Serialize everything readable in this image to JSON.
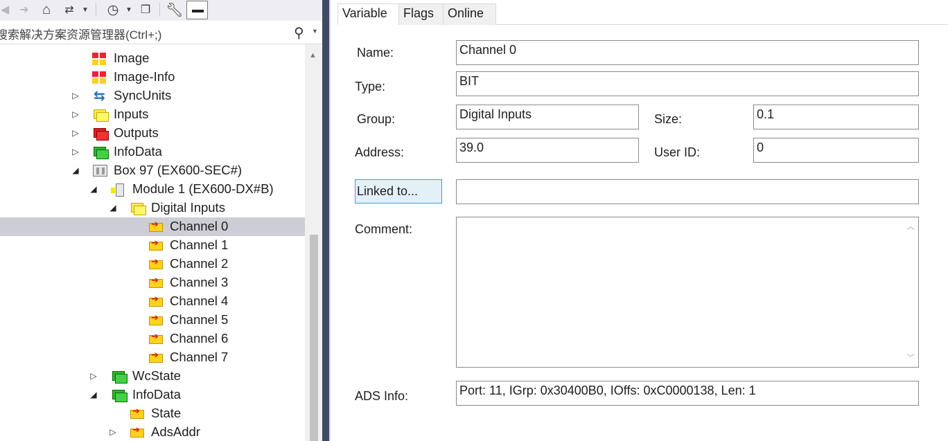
{
  "toolbar": {
    "icons": [
      "back-arrow-icon",
      "forward-arrow-icon",
      "home-icon",
      "sync-view-icon",
      "history-icon",
      "collapse-all-icon",
      "wrench-icon",
      "pin-icon"
    ]
  },
  "search": {
    "placeholder": "搜索解决方案资源管理器(Ctrl+;)",
    "icon": "search-icon"
  },
  "tree": {
    "items": [
      {
        "label": "Image",
        "icon": "image-icon",
        "expander": ""
      },
      {
        "label": "Image-Info",
        "icon": "image-info-icon",
        "expander": ""
      },
      {
        "label": "SyncUnits",
        "icon": "syncunits-icon",
        "expander": "collapsed"
      },
      {
        "label": "Inputs",
        "icon": "inputs-icon",
        "expander": "collapsed"
      },
      {
        "label": "Outputs",
        "icon": "outputs-icon",
        "expander": "collapsed"
      },
      {
        "label": "InfoData",
        "icon": "infodata-icon",
        "expander": "collapsed"
      },
      {
        "label": "Box 97 (EX600-SEC#)",
        "icon": "box-icon",
        "expander": "expanded"
      },
      {
        "label": "Module 1 (EX600-DX#B)",
        "icon": "module-icon",
        "expander": "expanded"
      },
      {
        "label": "Digital Inputs",
        "icon": "inputs-icon",
        "expander": "expanded"
      },
      {
        "label": "Channel 0",
        "icon": "variable-icon",
        "expander": "",
        "selected": true
      },
      {
        "label": "Channel 1",
        "icon": "variable-icon",
        "expander": ""
      },
      {
        "label": "Channel 2",
        "icon": "variable-icon",
        "expander": ""
      },
      {
        "label": "Channel 3",
        "icon": "variable-icon",
        "expander": ""
      },
      {
        "label": "Channel 4",
        "icon": "variable-icon",
        "expander": ""
      },
      {
        "label": "Channel 5",
        "icon": "variable-icon",
        "expander": ""
      },
      {
        "label": "Channel 6",
        "icon": "variable-icon",
        "expander": ""
      },
      {
        "label": "Channel 7",
        "icon": "variable-icon",
        "expander": ""
      },
      {
        "label": "WcState",
        "icon": "wcstate-icon",
        "expander": "collapsed"
      },
      {
        "label": "InfoData",
        "icon": "infodata-icon",
        "expander": "expanded"
      },
      {
        "label": "State",
        "icon": "variable-icon",
        "expander": ""
      },
      {
        "label": "AdsAddr",
        "icon": "variable-icon",
        "expander": "collapsed"
      }
    ]
  },
  "tabs": [
    {
      "label": "Variable",
      "active": true
    },
    {
      "label": "Flags",
      "active": false
    },
    {
      "label": "Online",
      "active": false
    }
  ],
  "form": {
    "name_label": "Name:",
    "name_value": "Channel 0",
    "type_label": "Type:",
    "type_value": "BIT",
    "group_label": "Group:",
    "group_value": "Digital Inputs",
    "size_label": "Size:",
    "size_value": "0.1",
    "address_label": "Address:",
    "address_value": "39.0",
    "userid_label": "User ID:",
    "userid_value": "0",
    "linked_button": "Linked to...",
    "linked_value": "",
    "comment_label": "Comment:",
    "comment_value": "",
    "ads_label": "ADS Info:",
    "ads_value": "Port: 11, IGrp: 0x30400B0, IOffs: 0xC0000138, Len: 1"
  },
  "colors": {
    "selection": "#cdcdd6",
    "splitter": "#3f4a66",
    "linked_button_border": "#3c9ed8"
  }
}
